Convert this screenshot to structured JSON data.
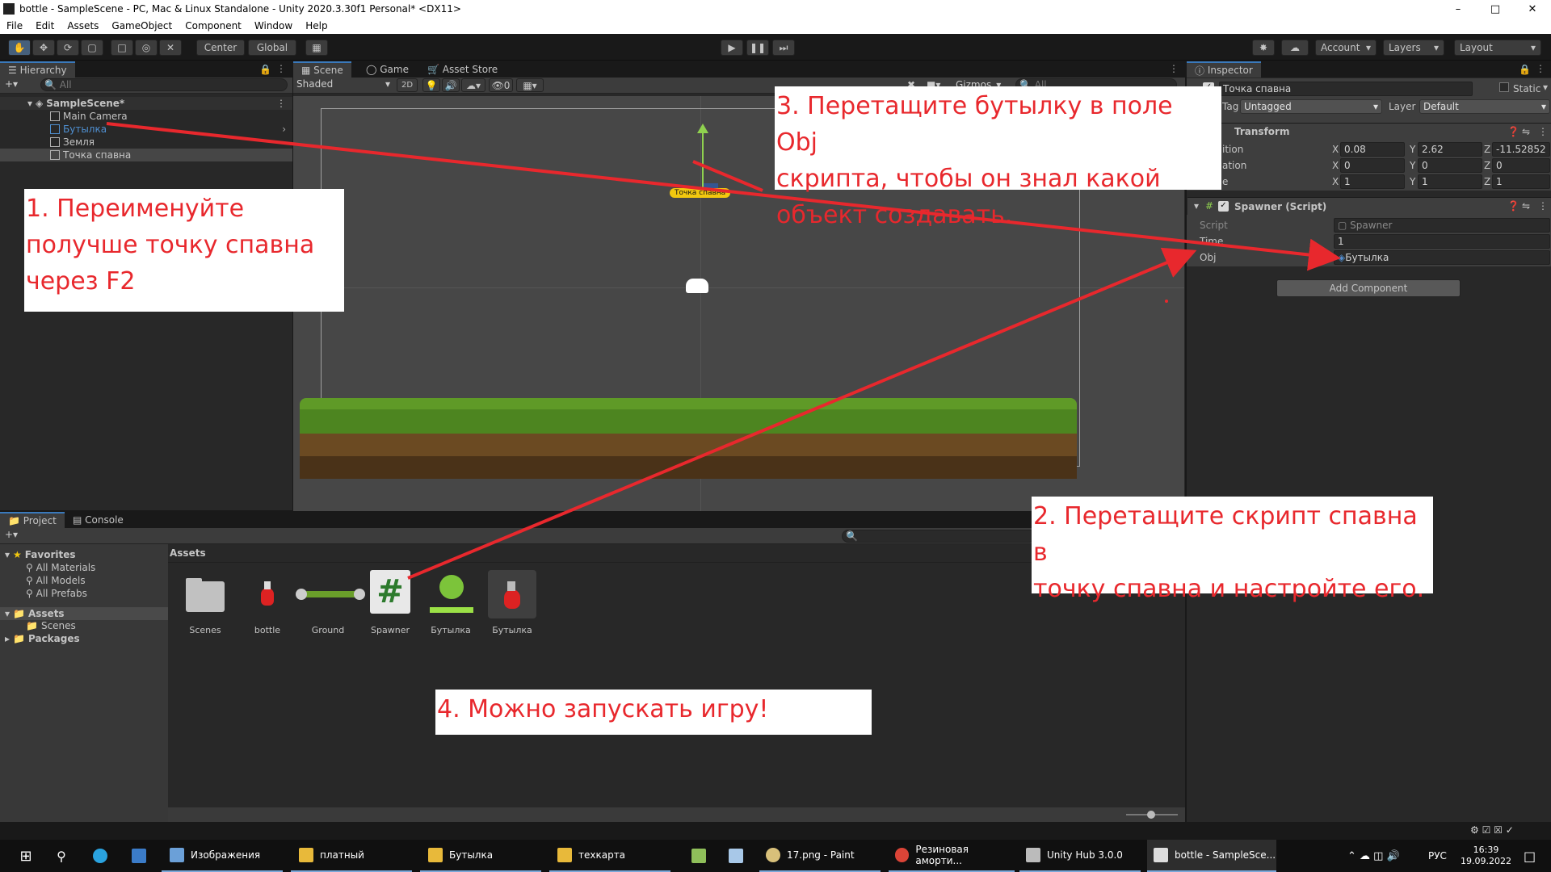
{
  "window": {
    "title": "bottle - SampleScene - PC, Mac & Linux Standalone - Unity 2020.3.30f1 Personal* <DX11>",
    "controls": [
      "–",
      "□",
      "✕"
    ]
  },
  "menu": [
    "File",
    "Edit",
    "Assets",
    "GameObject",
    "Component",
    "Window",
    "Help"
  ],
  "toolbar": {
    "pivot": "Center",
    "space": "Global",
    "account": "Account",
    "layers": "Layers",
    "layout": "Layout"
  },
  "hierarchy": {
    "tab": "Hierarchy",
    "search_placeholder": "All",
    "scene": "SampleScene*",
    "items": [
      "Main Camera",
      "Бутылка",
      "Земля",
      "Точка спавна"
    ]
  },
  "scene": {
    "tabs": [
      "Scene",
      "Game",
      "Asset Store"
    ],
    "shading": "Shaded",
    "mode_2d": "2D",
    "hidden_count": "0",
    "gizmos": "Gizmos",
    "search_placeholder": "All",
    "object_label": "Точка спавна"
  },
  "inspector": {
    "tab": "Inspector",
    "object_name": "Точка спавна",
    "static_label": "Static",
    "tag_label": "Tag",
    "tag_value": "Untagged",
    "layer_label": "Layer",
    "layer_value": "Default",
    "transform": {
      "title": "Transform",
      "rows": [
        {
          "label": "ition",
          "x": "0.08",
          "y": "2.62",
          "z": "-11.52852"
        },
        {
          "label": "ation",
          "x": "0",
          "y": "0",
          "z": "0"
        },
        {
          "label": "e",
          "x": "1",
          "y": "1",
          "z": "1"
        }
      ]
    },
    "spawner": {
      "title": "Spawner (Script)",
      "script_label": "Script",
      "script_value": "Spawner",
      "time_label": "Time",
      "time_value": "1",
      "obj_label": "Obj",
      "obj_value": "Бутылка"
    },
    "add_component": "Add Component"
  },
  "project": {
    "tabs": [
      "Project",
      "Console"
    ],
    "favorites_title": "Favorites",
    "favorites": [
      "All Materials",
      "All Models",
      "All Prefabs"
    ],
    "assets_root": "Assets",
    "assets_children": [
      "Scenes"
    ],
    "packages": "Packages",
    "breadcrumb": "Assets",
    "assets": [
      "Scenes",
      "bottle",
      "Ground",
      "Spawner",
      "Бутылка",
      "Бутылка"
    ]
  },
  "annotations": {
    "note1": [
      "1. Переименуйте",
      "получше точку спавна",
      "через F2"
    ],
    "note2": [
      "2. Перетащите скрипт спавна в",
      "точку спавна и настройте его."
    ],
    "note3": [
      "3. Перетащите бутылку в поле Obj",
      "скрипта, чтобы он знал какой",
      "объект создавать."
    ],
    "note4": "4. Можно запускать игру!",
    "color": "#e8282d"
  },
  "taskbar": {
    "items": [
      "Изображения",
      "платный",
      "Бутылка",
      "техкарта",
      "17.png - Paint",
      "Резиновая аморти...",
      "Unity Hub 3.0.0",
      "bottle - SampleSce..."
    ],
    "lang": "РУС",
    "time": "16:39",
    "date": "19.09.2022"
  },
  "colors": {
    "selection": "#2c5d87",
    "accent": "#3a79bb",
    "annotation": "#e8282d",
    "grass": "#6a9e2a",
    "dirt": "#6b4a22"
  }
}
